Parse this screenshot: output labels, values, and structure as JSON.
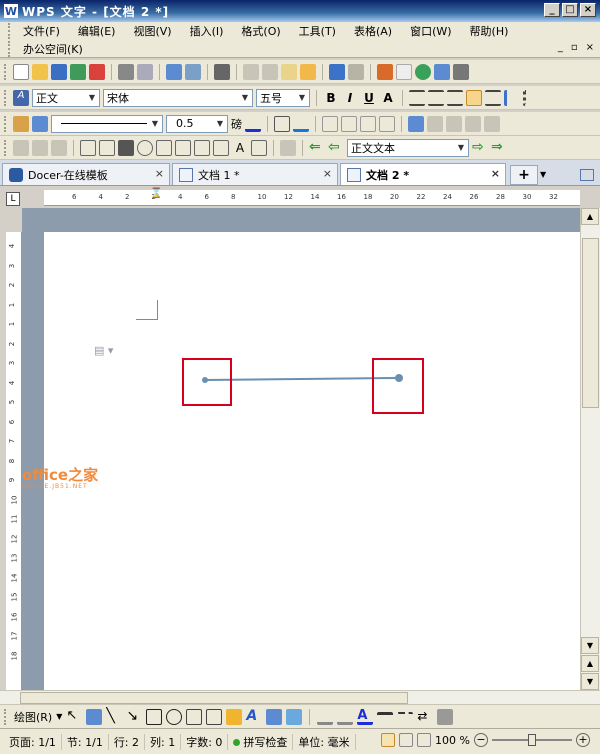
{
  "window": {
    "title": "WPS 文字 - [文档 2 *]",
    "logo": "W"
  },
  "menu": {
    "items": [
      "文件(F)",
      "编辑(E)",
      "视图(V)",
      "插入(I)",
      "格式(O)",
      "工具(T)",
      "表格(A)",
      "窗口(W)",
      "帮助(H)"
    ],
    "second_row": [
      "办公空间(K)"
    ]
  },
  "format": {
    "style": "正文",
    "font": "宋体",
    "size": "五号",
    "line_weight": "0.5",
    "line_unit": "磅",
    "paragraph_style": "正文文本"
  },
  "tabs": [
    {
      "label": "Docer-在线模板",
      "active": false
    },
    {
      "label": "文档 1 *",
      "active": false
    },
    {
      "label": "文档 2 *",
      "active": true
    }
  ],
  "ruler": {
    "h_labels": [
      "6",
      "4",
      "2",
      "2",
      "4",
      "6",
      "8",
      "10",
      "12",
      "14",
      "16",
      "18",
      "20",
      "22",
      "24",
      "26",
      "28",
      "30",
      "32"
    ],
    "v_labels": [
      "4",
      "3",
      "2",
      "1",
      "1",
      "2",
      "3",
      "4",
      "5",
      "6",
      "7",
      "8",
      "9",
      "10",
      "11",
      "12",
      "13",
      "14",
      "15",
      "16",
      "17",
      "18"
    ]
  },
  "document": {
    "watermark": "office之家",
    "watermark_sub": "OFFICE.JB51.NET",
    "line_color": "#6a8fb0",
    "highlight_color": "#d6001c"
  },
  "drawbar": {
    "label": "绘图(R)"
  },
  "status": {
    "page": "页面: 1/1",
    "section": "节: 1/1",
    "row": "行: 2",
    "col": "列: 1",
    "words": "字数: 0",
    "spellcheck": "拼写检查",
    "unit": "单位: 毫米",
    "zoom": "100 %"
  }
}
